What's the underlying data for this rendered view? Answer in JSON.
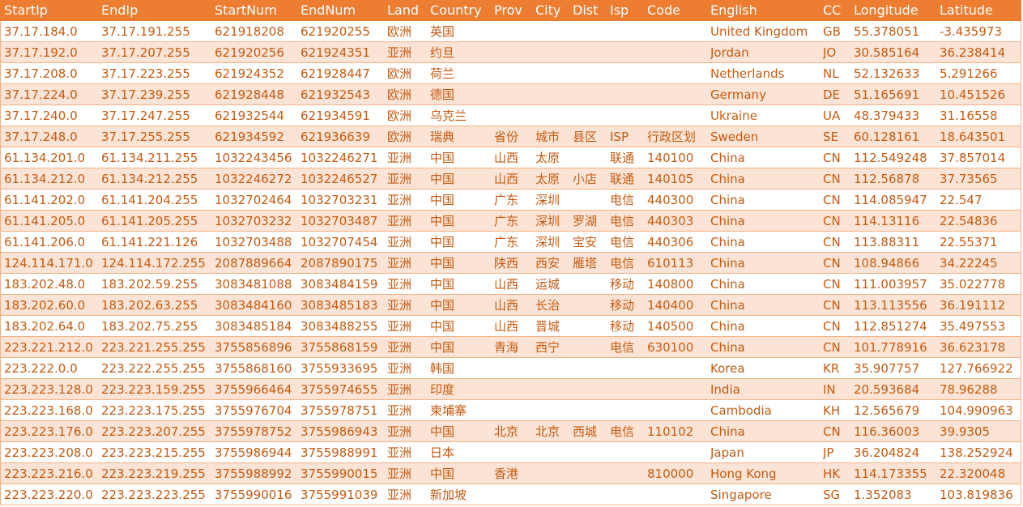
{
  "table": {
    "headers": [
      "StartIp",
      "EndIp",
      "StartNum",
      "EndNum",
      "Land",
      "Country",
      "Prov",
      "City",
      "Dist",
      "Isp",
      "Code",
      "English",
      "CC",
      "Longitude",
      "Latitude"
    ],
    "rows": [
      [
        "37.17.184.0",
        "37.17.191.255",
        "621918208",
        "621920255",
        "欧洲",
        "英国",
        "",
        "",
        "",
        "",
        "",
        "United Kingdom",
        "GB",
        "55.378051",
        "-3.435973"
      ],
      [
        "37.17.192.0",
        "37.17.207.255",
        "621920256",
        "621924351",
        "亚洲",
        "约旦",
        "",
        "",
        "",
        "",
        "",
        "Jordan",
        "JO",
        "30.585164",
        "36.238414"
      ],
      [
        "37.17.208.0",
        "37.17.223.255",
        "621924352",
        "621928447",
        "欧洲",
        "荷兰",
        "",
        "",
        "",
        "",
        "",
        "Netherlands",
        "NL",
        "52.132633",
        "5.291266"
      ],
      [
        "37.17.224.0",
        "37.17.239.255",
        "621928448",
        "621932543",
        "欧洲",
        "德国",
        "",
        "",
        "",
        "",
        "",
        "Germany",
        "DE",
        "51.165691",
        "10.451526"
      ],
      [
        "37.17.240.0",
        "37.17.247.255",
        "621932544",
        "621934591",
        "欧洲",
        "乌克兰",
        "",
        "",
        "",
        "",
        "",
        "Ukraine",
        "UA",
        "48.379433",
        "31.16558"
      ],
      [
        "37.17.248.0",
        "37.17.255.255",
        "621934592",
        "621936639",
        "欧洲",
        "瑞典",
        "省份",
        "城市",
        "县区",
        "ISP",
        "行政区划",
        "Sweden",
        "SE",
        "60.128161",
        "18.643501"
      ],
      [
        "61.134.201.0",
        "61.134.211.255",
        "1032243456",
        "1032246271",
        "亚洲",
        "中国",
        "山西",
        "太原",
        "",
        "联通",
        "140100",
        "China",
        "CN",
        "112.549248",
        "37.857014"
      ],
      [
        "61.134.212.0",
        "61.134.212.255",
        "1032246272",
        "1032246527",
        "亚洲",
        "中国",
        "山西",
        "太原",
        "小店",
        "联通",
        "140105",
        "China",
        "CN",
        "112.56878",
        "37.73565"
      ],
      [
        "61.141.202.0",
        "61.141.204.255",
        "1032702464",
        "1032703231",
        "亚洲",
        "中国",
        "广东",
        "深圳",
        "",
        "电信",
        "440300",
        "China",
        "CN",
        "114.085947",
        "22.547"
      ],
      [
        "61.141.205.0",
        "61.141.205.255",
        "1032703232",
        "1032703487",
        "亚洲",
        "中国",
        "广东",
        "深圳",
        "罗湖",
        "电信",
        "440303",
        "China",
        "CN",
        "114.13116",
        "22.54836"
      ],
      [
        "61.141.206.0",
        "61.141.221.126",
        "1032703488",
        "1032707454",
        "亚洲",
        "中国",
        "广东",
        "深圳",
        "宝安",
        "电信",
        "440306",
        "China",
        "CN",
        "113.88311",
        "22.55371"
      ],
      [
        "124.114.171.0",
        "124.114.172.255",
        "2087889664",
        "2087890175",
        "亚洲",
        "中国",
        "陕西",
        "西安",
        "雁塔",
        "电信",
        "610113",
        "China",
        "CN",
        "108.94866",
        "34.22245"
      ],
      [
        "183.202.48.0",
        "183.202.59.255",
        "3083481088",
        "3083484159",
        "亚洲",
        "中国",
        "山西",
        "运城",
        "",
        "移动",
        "140800",
        "China",
        "CN",
        "111.003957",
        "35.022778"
      ],
      [
        "183.202.60.0",
        "183.202.63.255",
        "3083484160",
        "3083485183",
        "亚洲",
        "中国",
        "山西",
        "长治",
        "",
        "移动",
        "140400",
        "China",
        "CN",
        "113.113556",
        "36.191112"
      ],
      [
        "183.202.64.0",
        "183.202.75.255",
        "3083485184",
        "3083488255",
        "亚洲",
        "中国",
        "山西",
        "晋城",
        "",
        "移动",
        "140500",
        "China",
        "CN",
        "112.851274",
        "35.497553"
      ],
      [
        "223.221.212.0",
        "223.221.255.255",
        "3755856896",
        "3755868159",
        "亚洲",
        "中国",
        "青海",
        "西宁",
        "",
        "电信",
        "630100",
        "China",
        "CN",
        "101.778916",
        "36.623178"
      ],
      [
        "223.222.0.0",
        "223.222.255.255",
        "3755868160",
        "3755933695",
        "亚洲",
        "韩国",
        "",
        "",
        "",
        "",
        "",
        "Korea",
        "KR",
        "35.907757",
        "127.766922"
      ],
      [
        "223.223.128.0",
        "223.223.159.255",
        "3755966464",
        "3755974655",
        "亚洲",
        "印度",
        "",
        "",
        "",
        "",
        "",
        "India",
        "IN",
        "20.593684",
        "78.96288"
      ],
      [
        "223.223.168.0",
        "223.223.175.255",
        "3755976704",
        "3755978751",
        "亚洲",
        "柬埔寨",
        "",
        "",
        "",
        "",
        "",
        "Cambodia",
        "KH",
        "12.565679",
        "104.990963"
      ],
      [
        "223.223.176.0",
        "223.223.207.255",
        "3755978752",
        "3755986943",
        "亚洲",
        "中国",
        "北京",
        "北京",
        "西城",
        "电信",
        "110102",
        "China",
        "CN",
        "116.36003",
        "39.9305"
      ],
      [
        "223.223.208.0",
        "223.223.215.255",
        "3755986944",
        "3755988991",
        "亚洲",
        "日本",
        "",
        "",
        "",
        "",
        "",
        "Japan",
        "JP",
        "36.204824",
        "138.252924"
      ],
      [
        "223.223.216.0",
        "223.223.219.255",
        "3755988992",
        "3755990015",
        "亚洲",
        "中国",
        "香港",
        "",
        "",
        "",
        "810000",
        "Hong Kong",
        "HK",
        "114.173355",
        "22.320048"
      ],
      [
        "223.223.220.0",
        "223.223.223.255",
        "3755990016",
        "3755991039",
        "亚洲",
        "新加坡",
        "",
        "",
        "",
        "",
        "",
        "Singapore",
        "SG",
        "1.352083",
        "103.819836"
      ]
    ]
  }
}
